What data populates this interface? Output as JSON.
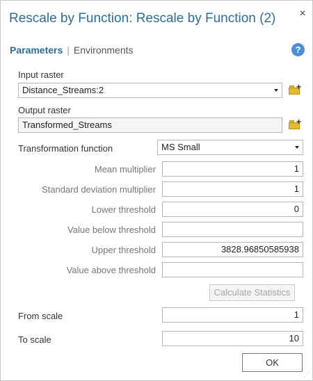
{
  "window": {
    "title": "Rescale by Function: Rescale by Function (2)",
    "close_label": "×"
  },
  "tabs": {
    "parameters": "Parameters",
    "separator": "|",
    "environments": "Environments",
    "help": "?"
  },
  "input_raster": {
    "label": "Input raster",
    "value": "Distance_Streams:2"
  },
  "output_raster": {
    "label": "Output raster",
    "value": "Transformed_Streams"
  },
  "transformation": {
    "label": "Transformation function",
    "value": "MS Small"
  },
  "params": {
    "mean_multiplier": {
      "label": "Mean multiplier",
      "value": "1"
    },
    "std_multiplier": {
      "label": "Standard deviation multiplier",
      "value": "1"
    },
    "lower_threshold": {
      "label": "Lower threshold",
      "value": "0"
    },
    "value_below": {
      "label": "Value below threshold",
      "value": ""
    },
    "upper_threshold": {
      "label": "Upper threshold",
      "value": "3828.96850585938"
    },
    "value_above": {
      "label": "Value above threshold",
      "value": ""
    }
  },
  "calculate_button": "Calculate Statistics",
  "from_scale": {
    "label": "From scale",
    "value": "1"
  },
  "to_scale": {
    "label": "To scale",
    "value": "10"
  },
  "ok_button": "OK",
  "icons": {
    "folder_add": "folder-add-icon",
    "dropdown": "chevron-down-icon",
    "help": "help-icon",
    "close": "close-icon"
  },
  "colors": {
    "title": "#2b6ca3",
    "help_bg": "#4a90d9",
    "folder": "#e6b82e"
  }
}
